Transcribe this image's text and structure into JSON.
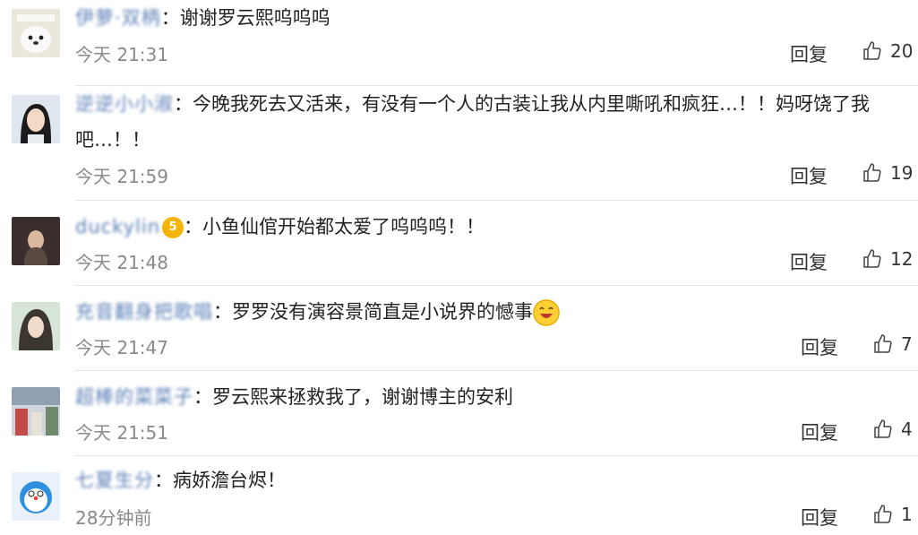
{
  "comments": [
    {
      "user": "伊萝·双柄",
      "text": "谢谢罗云熙呜呜呜",
      "time": "今天 21:31",
      "reply": "回复",
      "likes": "20"
    },
    {
      "user": "逆逆小小淑",
      "text_line1": "今晚我死去又活来，有没有一个人的古装让我从内里嘶吼和疯狂…！！妈呀饶了我",
      "text_line2": "吧…！！",
      "time": "今天 21:59",
      "reply": "回复",
      "likes": "19"
    },
    {
      "user": "duckylin",
      "badge": "5",
      "text": "小鱼仙倌开始都太爱了呜呜呜！！",
      "time": "今天 21:48",
      "reply": "回复",
      "likes": "12"
    },
    {
      "user": "充音翻身把歌唱",
      "text": "罗罗没有演容景简直是小说界的憾事",
      "time": "今天 21:47",
      "reply": "回复",
      "likes": "7"
    },
    {
      "user": "超棒的菜菜子",
      "text": "罗云熙来拯救我了，谢谢博主的安利",
      "time": "今天 21:51",
      "reply": "回复",
      "likes": "4"
    },
    {
      "user": "七夏生分",
      "text": "病娇澹台烬！",
      "time": "28分钟前",
      "reply": "回复",
      "likes": "1"
    }
  ],
  "colon": "：",
  "icons": {
    "like": "thumbs-up-icon",
    "emoji": "grinning-face-icon"
  },
  "colors": {
    "username": "#5a7fb5",
    "meta": "#8a8a8a",
    "divider": "#e6e6e6"
  }
}
